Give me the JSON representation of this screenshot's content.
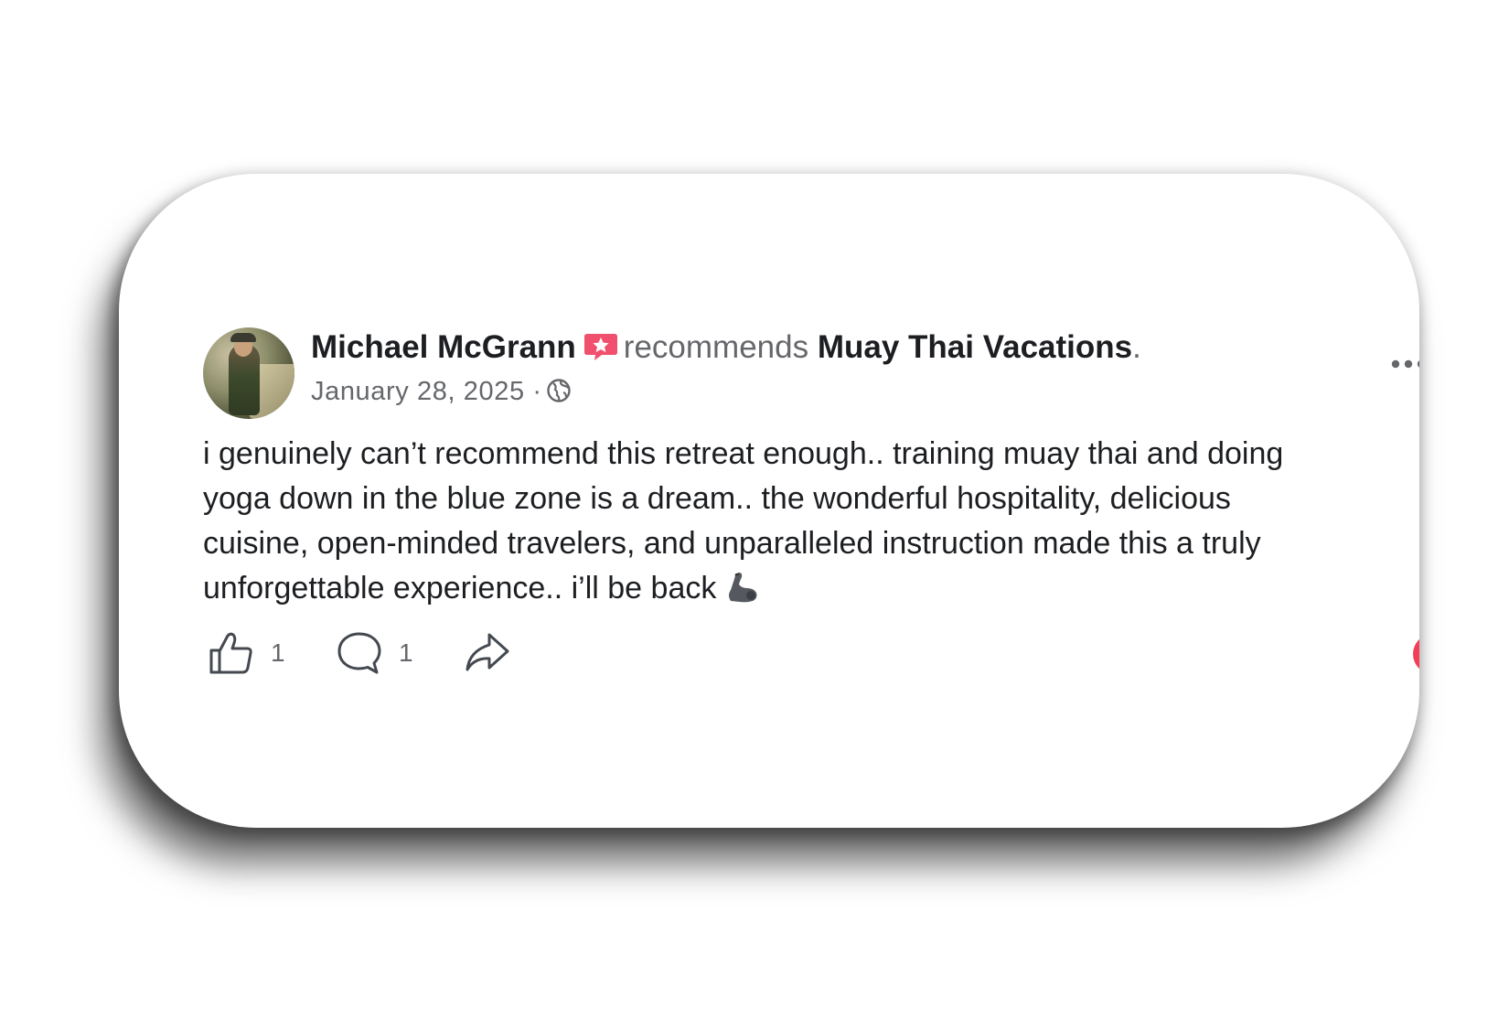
{
  "post": {
    "author": "Michael McGrann",
    "verb": "recommends",
    "page": "Muay Thai Vacations",
    "period": ".",
    "date": "January 28, 2025 ·",
    "body": "i genuinely can’t recommend this retreat enough.. training muay thai and doing yoga down in the blue zone is a dream.. the wonderful hospitality, delicious cuisine, open-minded travelers, and unparalleled instruction made this a truly unforgettable experience.. i’ll be back",
    "icons": {
      "recommendation": "recommendation-star-icon",
      "audience": "globe-icon",
      "emoji": "flexed-biceps-icon",
      "more": "more-options-icon",
      "reaction": "love-reaction-icon"
    }
  },
  "actions": {
    "like_count": "1",
    "comment_count": "1"
  },
  "colors": {
    "recommend_badge": "#f0506e",
    "love": "#f33e58",
    "secondary_text": "#65676b",
    "primary_text": "#1c1e21"
  }
}
